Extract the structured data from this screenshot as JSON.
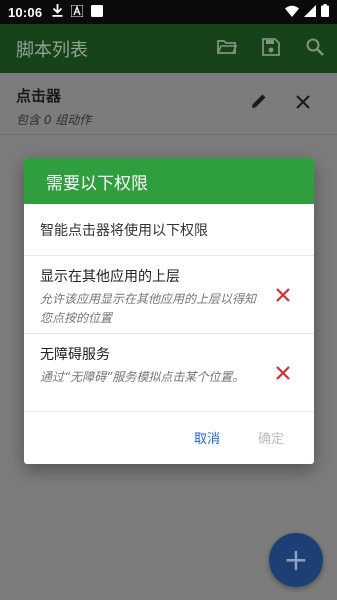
{
  "status_bar": {
    "time": "10:06",
    "icons": [
      "download-icon",
      "a-notification-icon",
      "square-notification-icon",
      "wifi-icon",
      "signal-icon",
      "battery-icon"
    ]
  },
  "app_bar": {
    "title": "脚本列表",
    "actions": [
      "folder-open-icon",
      "save-icon",
      "search-icon"
    ]
  },
  "script_list": {
    "items": [
      {
        "name": "点击器",
        "subtitle": "包含 0 组动作"
      }
    ]
  },
  "fab": {
    "label": "+"
  },
  "dialog": {
    "title": "需要以下权限",
    "intro": "智能点击器将使用以下权限",
    "permissions": [
      {
        "title": "显示在其他应用的上层",
        "description": "允许该应用显示在其他应用的上层以得知您点按的位置",
        "status": "denied"
      },
      {
        "title": "无障碍服务",
        "description": "通过“无障碍”服务模拟点击某个位置。",
        "status": "denied"
      }
    ],
    "cancel_label": "取消",
    "ok_label": "确定"
  },
  "colors": {
    "dialog_header": "#2e9e3e",
    "denied_mark": "#d32f2f",
    "cancel_text": "#1f66cc",
    "ok_disabled_text": "#bdbdbd"
  }
}
